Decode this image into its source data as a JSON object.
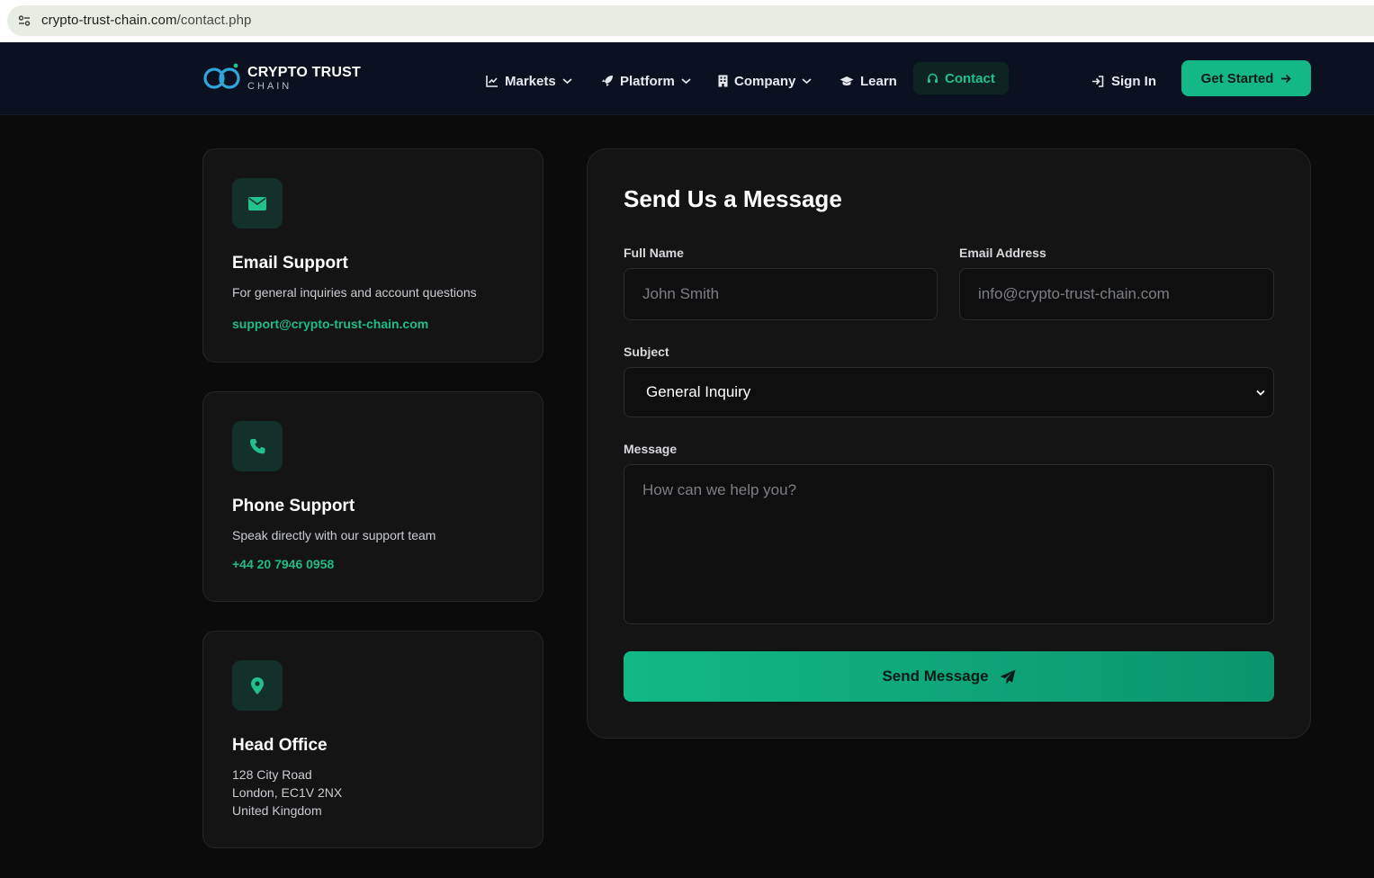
{
  "browser": {
    "url_domain": "crypto-trust-chain.com",
    "url_path": "/contact.php"
  },
  "brand": {
    "name": "CRYPTO TRUST",
    "sub": "CHAIN"
  },
  "nav": {
    "items": [
      {
        "label": "Markets",
        "icon": "chart-line-icon",
        "dropdown": true
      },
      {
        "label": "Platform",
        "icon": "rocket-icon",
        "dropdown": true
      },
      {
        "label": "Company",
        "icon": "building-icon",
        "dropdown": true
      },
      {
        "label": "Learn",
        "icon": "graduation-cap-icon",
        "dropdown": false
      },
      {
        "label": "Contact",
        "icon": "headset-icon",
        "dropdown": false,
        "active": true
      }
    ],
    "signin_label": "Sign In",
    "cta_label": "Get Started"
  },
  "cards": {
    "email": {
      "icon": "envelope-icon",
      "title": "Email Support",
      "desc": "For general inquiries and account questions",
      "link": "support@crypto-trust-chain.com"
    },
    "phone": {
      "icon": "phone-icon",
      "title": "Phone Support",
      "desc": "Speak directly with our support team",
      "link": "+44 20 7946 0958"
    },
    "office": {
      "icon": "map-pin-icon",
      "title": "Head Office",
      "lines": [
        "128 City Road",
        "London, EC1V 2NX",
        "United Kingdom"
      ]
    }
  },
  "form": {
    "title": "Send Us a Message",
    "fullname_label": "Full Name",
    "fullname_placeholder": "John Smith",
    "email_label": "Email Address",
    "email_placeholder": "info@crypto-trust-chain.com",
    "subject_label": "Subject",
    "subject_value": "General Inquiry",
    "message_label": "Message",
    "message_placeholder": "How can we help you?",
    "submit_label": "Send Message"
  },
  "colors": {
    "accent": "#14b886",
    "background": "#0b0b0b",
    "navbar": "#0b1120",
    "card": "#141414"
  }
}
